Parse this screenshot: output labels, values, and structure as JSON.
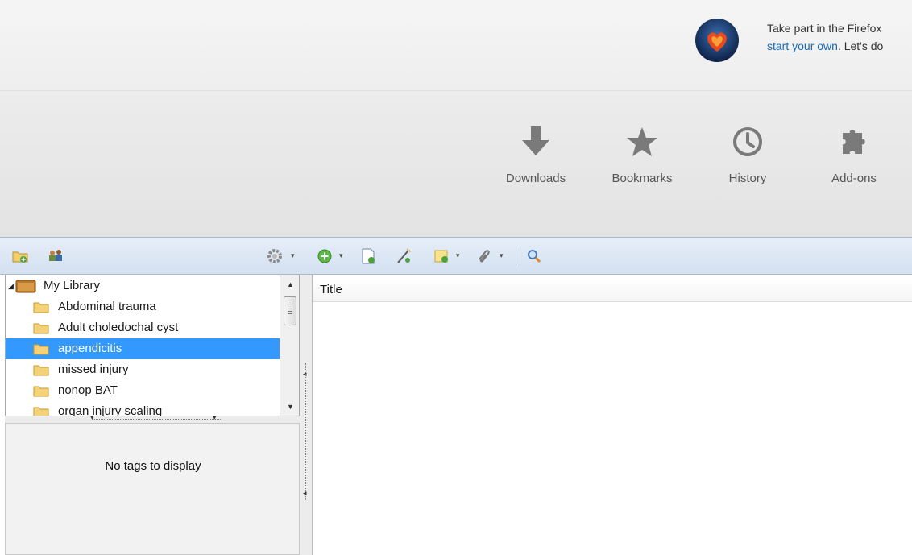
{
  "snippet": {
    "line1": "Take part in the Firefox",
    "line2_link": "start your own",
    "line2_rest": ". Let's do"
  },
  "launcher": {
    "downloads": "Downloads",
    "bookmarks": "Bookmarks",
    "history": "History",
    "addons": "Add-ons"
  },
  "collections": {
    "root": "My Library",
    "items": [
      "Abdominal trauma",
      "Adult choledochal cyst",
      "appendicitis",
      "missed injury",
      "nonop BAT",
      "organ injury scaling"
    ],
    "selected_index": 2
  },
  "tags": {
    "message": "No tags to display"
  },
  "items_pane": {
    "column_title": "Title"
  },
  "colors": {
    "selection": "#3399ff",
    "toolbar": "#dce6f3",
    "link": "#1a6bb8"
  }
}
